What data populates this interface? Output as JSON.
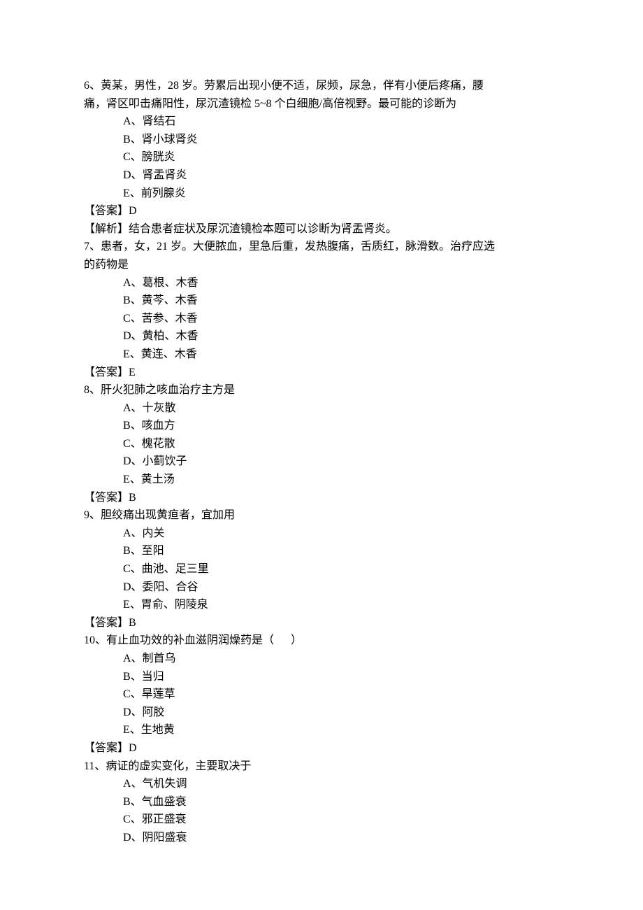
{
  "questions": [
    {
      "num": "6",
      "stem_lines": [
        "6、黄某，男性，28 岁。劳累后出现小便不适，尿频，尿急，伴有小便后疼痛，腰",
        "痛，肾区叩击痛阳性，尿沉渣镜检 5~8 个白细胞/高倍视野。最可能的诊断为"
      ],
      "options": [
        "A、肾结石",
        "B、肾小球肾炎",
        "C、膀胱炎",
        "D、肾盂肾炎",
        "E、前列腺炎"
      ],
      "answer": "【答案】D",
      "analysis": "【解析】结合患者症状及尿沉渣镜检本题可以诊断为肾盂肾炎。"
    },
    {
      "num": "7",
      "stem_lines": [
        "7、患者，女，21 岁。大便脓血，里急后重，发热腹痛，舌质红，脉滑数。治疗应选",
        "的药物是"
      ],
      "options": [
        "A、葛根、木香",
        "B、黄芩、木香",
        "C、苦参、木香",
        "D、黄柏、木香",
        "E、黄连、木香"
      ],
      "answer": "【答案】E",
      "analysis": null
    },
    {
      "num": "8",
      "stem_lines": [
        "8、肝火犯肺之咳血治疗主方是"
      ],
      "options": [
        "A、十灰散",
        "B、咳血方",
        "C、槐花散",
        "D、小蓟饮子",
        "E、黄土汤"
      ],
      "answer": "【答案】B",
      "analysis": null
    },
    {
      "num": "9",
      "stem_lines": [
        "9、胆绞痛出现黄疸者，宜加用"
      ],
      "options": [
        "A、内关",
        "B、至阳",
        "C、曲池、足三里",
        "D、委阳、合谷",
        "E、胃俞、阴陵泉"
      ],
      "answer": "【答案】B",
      "analysis": null
    },
    {
      "num": "10",
      "stem_lines": [
        "10、有止血功效的补血滋阴润燥药是（      ）"
      ],
      "options": [
        "A、制首乌",
        "B、当归",
        "C、旱莲草",
        "D、阿胶",
        "E、生地黄"
      ],
      "answer": "【答案】D",
      "analysis": null
    },
    {
      "num": "11",
      "stem_lines": [
        "11、病证的虚实变化，主要取决于"
      ],
      "options": [
        "A、气机失调",
        "B、气血盛衰",
        "C、邪正盛衰",
        "D、阴阳盛衰"
      ],
      "answer": null,
      "analysis": null
    }
  ]
}
